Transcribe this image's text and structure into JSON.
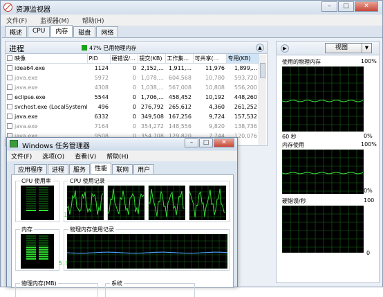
{
  "rm": {
    "title": "资源监视器",
    "window_buttons": {
      "minimize": "–",
      "maximize": "□",
      "close": "✕"
    },
    "menu": [
      "文件(F)",
      "监视器(M)",
      "帮助(H)"
    ],
    "tabs": [
      "概述",
      "CPU",
      "内存",
      "磁盘",
      "网络"
    ],
    "active_tab": "内存",
    "processes": {
      "title": "进程",
      "phys_mem_text": "47% 已用物理内存",
      "collapse_glyph": "▲",
      "columns": [
        "映像",
        "PID",
        "硬错误/...",
        "提交(KB)",
        "工作集...",
        "可共享(...",
        "专用(KB)"
      ],
      "rows": [
        {
          "name": "idea64.exe",
          "pid": "1124",
          "hard": "0",
          "commit": "2,152,...",
          "ws": "1,911,...",
          "share": "11,976",
          "priv": "1,899,...",
          "dim": false
        },
        {
          "name": "java.exe",
          "pid": "5972",
          "hard": "0",
          "commit": "1,078,...",
          "ws": "604,568",
          "share": "10,780",
          "priv": "593,720",
          "dim": true
        },
        {
          "name": "java.exe",
          "pid": "4308",
          "hard": "0",
          "commit": "1,038,...",
          "ws": "567,008",
          "share": "10,808",
          "priv": "556,200",
          "dim": true
        },
        {
          "name": "eclipse.exe",
          "pid": "5544",
          "hard": "0",
          "commit": "1,706,...",
          "ws": "458,452",
          "share": "10,192",
          "priv": "448,260",
          "dim": false
        },
        {
          "name": "svchost.exe (LocalSystemN...",
          "pid": "496",
          "hard": "0",
          "commit": "276,792",
          "ws": "265,612",
          "share": "4,360",
          "priv": "261,252",
          "dim": false
        },
        {
          "name": "java.exe",
          "pid": "6332",
          "hard": "0",
          "commit": "349,508",
          "ws": "167,256",
          "share": "9,724",
          "priv": "157,532",
          "dim": false
        },
        {
          "name": "java.exe",
          "pid": "7164",
          "hard": "0",
          "commit": "354,272",
          "ws": "148,556",
          "share": "9,820",
          "priv": "138,736",
          "dim": true
        },
        {
          "name": "java.exe",
          "pid": "9508",
          "hard": "0",
          "commit": "354,708",
          "ws": "129,820",
          "share": "7,744",
          "priv": "120,076",
          "dim": true
        }
      ]
    },
    "graphs": {
      "expand_glyph": "▶",
      "view_button": "视图",
      "view_dropdown": "▼",
      "g1": {
        "title": "使用的物理内存",
        "max": "100%",
        "min": "0%",
        "time": "60 秒"
      },
      "g2": {
        "title": "内存使用",
        "max": "100%",
        "min": "0%"
      },
      "g3": {
        "title": "硬错误/秒",
        "max": "100",
        "min": "0"
      }
    }
  },
  "tm": {
    "title": "Windows 任务管理器",
    "window_buttons": {
      "minimize": "–",
      "maximize": "□",
      "close": "✕"
    },
    "menu": [
      "文件(F)",
      "选项(O)",
      "查看(V)",
      "帮助(H)"
    ],
    "tabs": [
      "应用程序",
      "进程",
      "服务",
      "性能",
      "联网",
      "用户"
    ],
    "active_tab": "性能",
    "cpu_usage": {
      "label": "CPU 使用率",
      "value": "11 %",
      "level": 0.11
    },
    "cpu_history": {
      "label": "CPU 使用记录"
    },
    "memory": {
      "label": "内存",
      "value": "5.86 GB",
      "level": 0.55
    },
    "mem_history": {
      "label": "物理内存使用记录"
    },
    "phys_mem_mb": {
      "label": "物理内存(MB)"
    },
    "system": {
      "label": "系统"
    }
  }
}
